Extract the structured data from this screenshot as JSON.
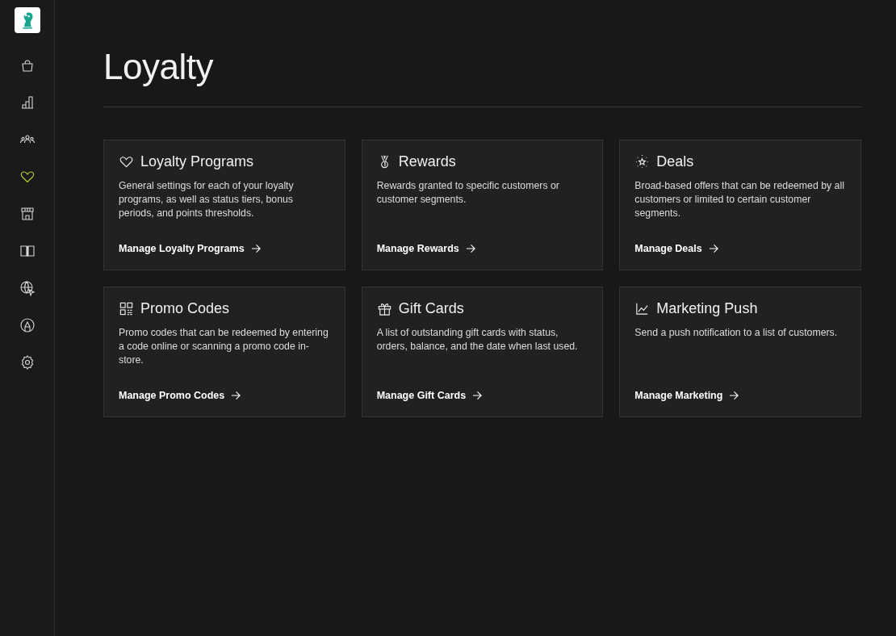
{
  "sidebar": {
    "items": [
      {
        "kind": "bag",
        "selected": false
      },
      {
        "kind": "chart",
        "selected": false
      },
      {
        "kind": "people",
        "selected": false
      },
      {
        "kind": "heart",
        "selected": true
      },
      {
        "kind": "store",
        "selected": false
      },
      {
        "kind": "book",
        "selected": false
      },
      {
        "kind": "globe",
        "selected": false
      },
      {
        "kind": "pen",
        "selected": false
      },
      {
        "kind": "gear",
        "selected": false
      }
    ]
  },
  "page": {
    "title": "Loyalty"
  },
  "cards": [
    {
      "kind": "heart",
      "title": "Loyalty Programs",
      "description": "General settings for each of your loyalty programs, as well as status tiers, bonus periods, and points thresholds.",
      "link": "Manage Loyalty Programs"
    },
    {
      "kind": "medal",
      "title": "Rewards",
      "description": "Rewards granted to specific customers or customer segments.",
      "link": "Manage Rewards"
    },
    {
      "kind": "star",
      "title": "Deals",
      "description": "Broad-based offers that can be redeemed by all customers or limited to certain customer segments.",
      "link": "Manage Deals"
    },
    {
      "kind": "qr",
      "title": "Promo Codes",
      "description": "Promo codes that can be redeemed by entering a code online or scanning a promo code in-store.",
      "link": "Manage Promo Codes"
    },
    {
      "kind": "gift",
      "title": "Gift Cards",
      "description": "A list of outstanding gift cards with status, orders, balance, and the date when last used.",
      "link": "Manage Gift Cards"
    },
    {
      "kind": "trend",
      "title": "Marketing Push",
      "description": "Send a push notification to a list of customers.",
      "link": "Manage Marketing"
    }
  ]
}
